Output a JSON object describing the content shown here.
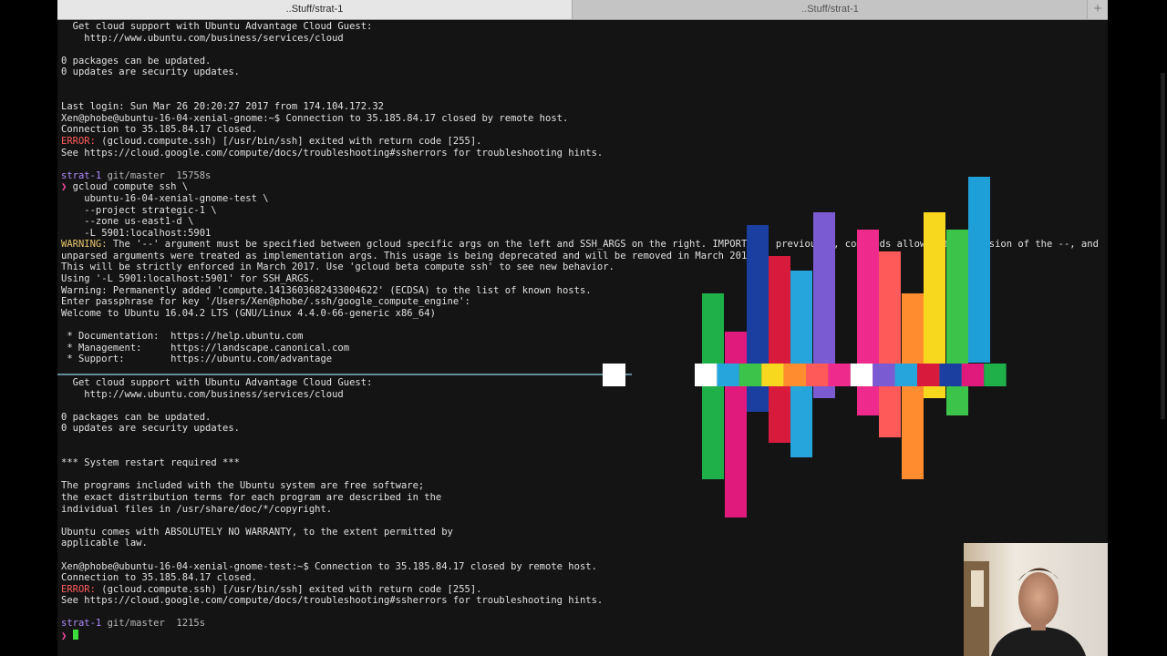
{
  "tabs": [
    {
      "label": "..Stuff/strat-1"
    },
    {
      "label": "..Stuff/strat-1"
    }
  ],
  "new_tab_icon": "plus-icon",
  "top_pane": [
    {
      "text": "  Get cloud support with Ubuntu Advantage Cloud Guest:",
      "style": "white"
    },
    {
      "text": "    http://www.ubuntu.com/business/services/cloud",
      "style": "white"
    },
    {
      "text": "",
      "style": "white"
    },
    {
      "text": "0 packages can be updated.",
      "style": "white"
    },
    {
      "text": "0 updates are security updates.",
      "style": "white"
    },
    {
      "text": "",
      "style": "white"
    },
    {
      "text": "",
      "style": "white"
    },
    {
      "text": "Last login: Sun Mar 26 20:20:27 2017 from 174.104.172.32",
      "style": "white"
    },
    {
      "text": "Xen@phobe@ubuntu-16-04-xenial-gnome:~$ Connection to 35.185.84.17 closed by remote host.",
      "style": "white"
    },
    {
      "text": "Connection to 35.185.84.17 closed.",
      "style": "white"
    },
    {
      "text": "(gcloud.compute.ssh) [/usr/bin/ssh] exited with return code [255].",
      "style": "white",
      "prefix": "ERROR: ",
      "prefix_style": "red"
    },
    {
      "text": "See https://cloud.google.com/compute/docs/troubleshooting#ssherrors for troubleshooting hints.",
      "style": "white"
    },
    {
      "text": "",
      "style": "white"
    },
    {
      "text": "git/master  15758s",
      "style": "gray",
      "prefix": "strat-1 ",
      "prefix_style": "purple"
    },
    {
      "text": "gcloud compute ssh \\",
      "style": "white",
      "prefix": "❯ ",
      "prefix_style": "magenta"
    },
    {
      "text": "    ubuntu-16-04-xenial-gnome-test \\",
      "style": "white"
    },
    {
      "text": "    --project strategic-1 \\",
      "style": "white"
    },
    {
      "text": "    --zone us-east1-d \\",
      "style": "white"
    },
    {
      "text": "    -L 5901:localhost:5901",
      "style": "white"
    },
    {
      "text": "The '--' argument must be specified between gcloud specific args on the left and SSH_ARGS on the right. IMPORTANT: previously, commands allowed the omission of the --, and",
      "style": "white",
      "prefix": "WARNING: ",
      "prefix_style": "yellow"
    },
    {
      "text": "unparsed arguments were treated as implementation args. This usage is being deprecated and will be removed in March 2017.",
      "style": "white"
    },
    {
      "text": "This will be strictly enforced in March 2017. Use 'gcloud beta compute ssh' to see new behavior.",
      "style": "white"
    },
    {
      "text": "Using '-L 5901:localhost:5901' for SSH_ARGS.",
      "style": "white"
    },
    {
      "text": "Warning: Permanently added 'compute.1413603682433004622' (ECDSA) to the list of known hosts.",
      "style": "white"
    },
    {
      "text": "Enter passphrase for key '/Users/Xen@phobe/.ssh/google_compute_engine':",
      "style": "white"
    },
    {
      "text": "Welcome to Ubuntu 16.04.2 LTS (GNU/Linux 4.4.0-66-generic x86_64)",
      "style": "white"
    },
    {
      "text": "",
      "style": "white"
    },
    {
      "text": " * Documentation:  https://help.ubuntu.com",
      "style": "white"
    },
    {
      "text": " * Management:     https://landscape.canonical.com",
      "style": "white"
    },
    {
      "text": " * Support:        https://ubuntu.com/advantage",
      "style": "white"
    }
  ],
  "bottom_pane": [
    {
      "text": "  Get cloud support with Ubuntu Advantage Cloud Guest:",
      "style": "white"
    },
    {
      "text": "    http://www.ubuntu.com/business/services/cloud",
      "style": "white"
    },
    {
      "text": "",
      "style": "white"
    },
    {
      "text": "0 packages can be updated.",
      "style": "white"
    },
    {
      "text": "0 updates are security updates.",
      "style": "white"
    },
    {
      "text": "",
      "style": "white"
    },
    {
      "text": "",
      "style": "white"
    },
    {
      "text": "*** System restart required ***",
      "style": "white"
    },
    {
      "text": "",
      "style": "white"
    },
    {
      "text": "The programs included with the Ubuntu system are free software;",
      "style": "white"
    },
    {
      "text": "the exact distribution terms for each program are described in the",
      "style": "white"
    },
    {
      "text": "individual files in /usr/share/doc/*/copyright.",
      "style": "white"
    },
    {
      "text": "",
      "style": "white"
    },
    {
      "text": "Ubuntu comes with ABSOLUTELY NO WARRANTY, to the extent permitted by",
      "style": "white"
    },
    {
      "text": "applicable law.",
      "style": "white"
    },
    {
      "text": "",
      "style": "white"
    },
    {
      "text": "Xen@phobe@ubuntu-16-04-xenial-gnome-test:~$ Connection to 35.185.84.17 closed by remote host.",
      "style": "white"
    },
    {
      "text": "Connection to 35.185.84.17 closed.",
      "style": "white"
    },
    {
      "text": "(gcloud.compute.ssh) [/usr/bin/ssh] exited with return code [255].",
      "style": "white",
      "prefix": "ERROR: ",
      "prefix_style": "red"
    },
    {
      "text": "See https://cloud.google.com/compute/docs/troubleshooting#ssherrors for troubleshooting hints.",
      "style": "white"
    },
    {
      "text": "",
      "style": "white"
    },
    {
      "text": "git/master  1215s",
      "style": "gray",
      "prefix": "strat-1 ",
      "prefix_style": "purple"
    },
    {
      "text": "",
      "style": "white",
      "prefix": "❯ ",
      "prefix_style": "magenta",
      "cursor": true
    }
  ],
  "visualizer": {
    "icon": "music-visualizer-overlay",
    "colors": [
      "#ffffff",
      "#1fb04a",
      "#e0197d",
      "#1a3fa0",
      "#d81b3c",
      "#25a5dc",
      "#7a5bd1",
      "#ee2a8d",
      "#ff5a5a",
      "#ff8c2e",
      "#f8d81e",
      "#3bc34a",
      "#1f9fd8"
    ]
  },
  "webcam": {
    "icon": "webcam-overlay"
  }
}
